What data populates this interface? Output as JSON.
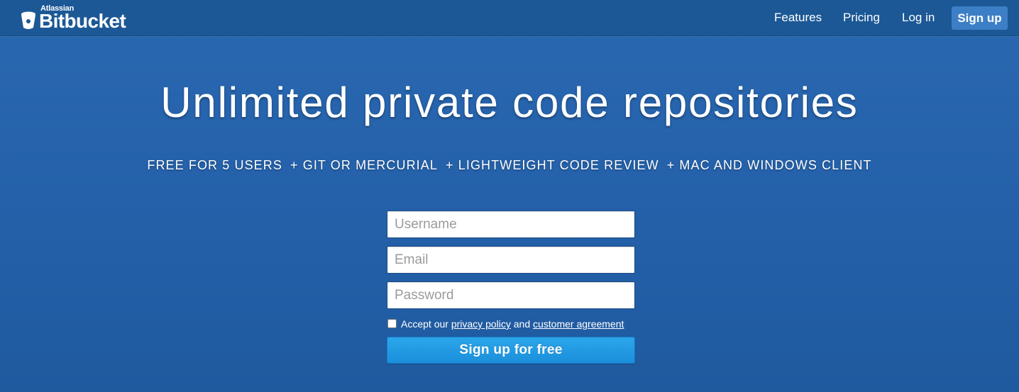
{
  "header": {
    "brand_small": "Atlassian",
    "brand_name": "Bitbucket",
    "nav": {
      "features": "Features",
      "pricing": "Pricing",
      "login": "Log in",
      "signup": "Sign up"
    }
  },
  "hero": {
    "title": "Unlimited private code repositories",
    "features": [
      "FREE FOR 5 USERS",
      "+ GIT OR MERCURIAL",
      "+ LIGHTWEIGHT CODE REVIEW",
      "+ MAC AND WINDOWS CLIENT"
    ]
  },
  "form": {
    "username_placeholder": "Username",
    "email_placeholder": "Email",
    "password_placeholder": "Password",
    "accept_prefix": "Accept our",
    "privacy_link": "privacy policy",
    "accept_and": "and",
    "agreement_link": "customer agreement",
    "accept_checked": false,
    "submit_label": "Sign up for free"
  },
  "colors": {
    "background": "#2663ac",
    "header": "#1c5896",
    "signup_nav_button": "#3c7fc6",
    "submit_button": "#1f96df"
  }
}
